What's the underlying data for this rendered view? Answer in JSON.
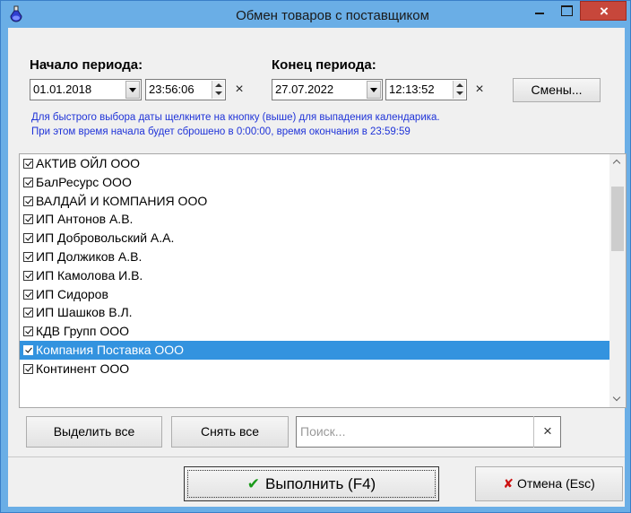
{
  "window": {
    "title": "Обмен товаров с поставщиком",
    "minimize": "–",
    "maximize": "□",
    "close": "×"
  },
  "period": {
    "start_label": "Начало периода:",
    "start_date": "01.01.2018",
    "start_time": "23:56:06",
    "end_label": "Конец периода:",
    "end_date": "27.07.2022",
    "end_time": "12:13:52",
    "clear_glyph": "×",
    "shifts_button": "Смены..."
  },
  "hint": {
    "line1": "Для быстрого выбора даты щелкните на кнопку (выше) для выпадения календарика.",
    "line2": "При этом время начала будет сброшено в 0:00:00, время окончания в 23:59:59"
  },
  "suppliers": [
    {
      "name": "АКТИВ ОЙЛ ООО",
      "checked": true,
      "selected": false
    },
    {
      "name": "БалРесурс ООО",
      "checked": true,
      "selected": false
    },
    {
      "name": "ВАЛДАЙ И КОМПАНИЯ ООО",
      "checked": true,
      "selected": false
    },
    {
      "name": "ИП Антонов А.В.",
      "checked": true,
      "selected": false
    },
    {
      "name": "ИП Добровольский А.А.",
      "checked": true,
      "selected": false
    },
    {
      "name": "ИП Должиков А.В.",
      "checked": true,
      "selected": false
    },
    {
      "name": "ИП Камолова И.В.",
      "checked": true,
      "selected": false
    },
    {
      "name": "ИП Сидоров",
      "checked": true,
      "selected": false
    },
    {
      "name": "ИП Шашков В.Л.",
      "checked": true,
      "selected": false
    },
    {
      "name": "КДВ Групп ООО",
      "checked": true,
      "selected": false
    },
    {
      "name": "Компания Поставка ООО",
      "checked": true,
      "selected": true
    },
    {
      "name": "Континент ООО",
      "checked": true,
      "selected": false
    }
  ],
  "toolbar": {
    "select_all": "Выделить все",
    "deselect_all": "Снять все",
    "search_placeholder": "Поиск...",
    "search_clear": "×"
  },
  "actions": {
    "run_label": "Выполнить (F4)",
    "cancel_label": "Отмена (Esc)"
  },
  "icons": {
    "run": "check-icon",
    "cancel": "cross-icon",
    "app": "flask-icon"
  },
  "colors": {
    "title_bar": "#6aaee6",
    "close_button": "#c7473b",
    "selection": "#3393df",
    "hint_text": "#1f33d8"
  }
}
